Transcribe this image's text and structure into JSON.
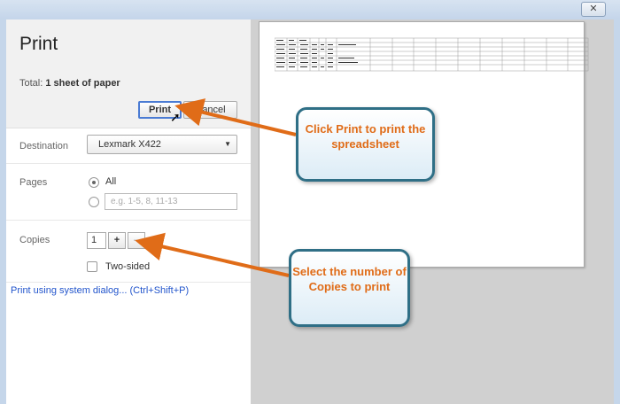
{
  "window": {
    "close_icon": "close-icon",
    "close_glyph": "✕"
  },
  "print_panel": {
    "title": "Print",
    "total_label": "Total:",
    "total_value": "1 sheet of paper",
    "print_button": "Print",
    "cancel_button": "Cancel",
    "destination_label": "Destination",
    "destination_value": "Lexmark X422",
    "pages_label": "Pages",
    "pages_all": "All",
    "pages_range_placeholder": "e.g. 1-5, 8, 11-13",
    "copies_label": "Copies",
    "copies_value": "1",
    "copies_plus": "+",
    "copies_minus": "–",
    "two_sided_label": "Two-sided",
    "system_dialog_link": "Print using system dialog... (Ctrl+Shift+P)"
  },
  "callouts": {
    "print": "Click Print to print the spreadsheet",
    "copies": "Select the number of Copies to print"
  },
  "colors": {
    "callout_text": "#e06c18",
    "callout_border": "#2f6f86",
    "arrow": "#e06c18",
    "link": "#2255cc"
  }
}
